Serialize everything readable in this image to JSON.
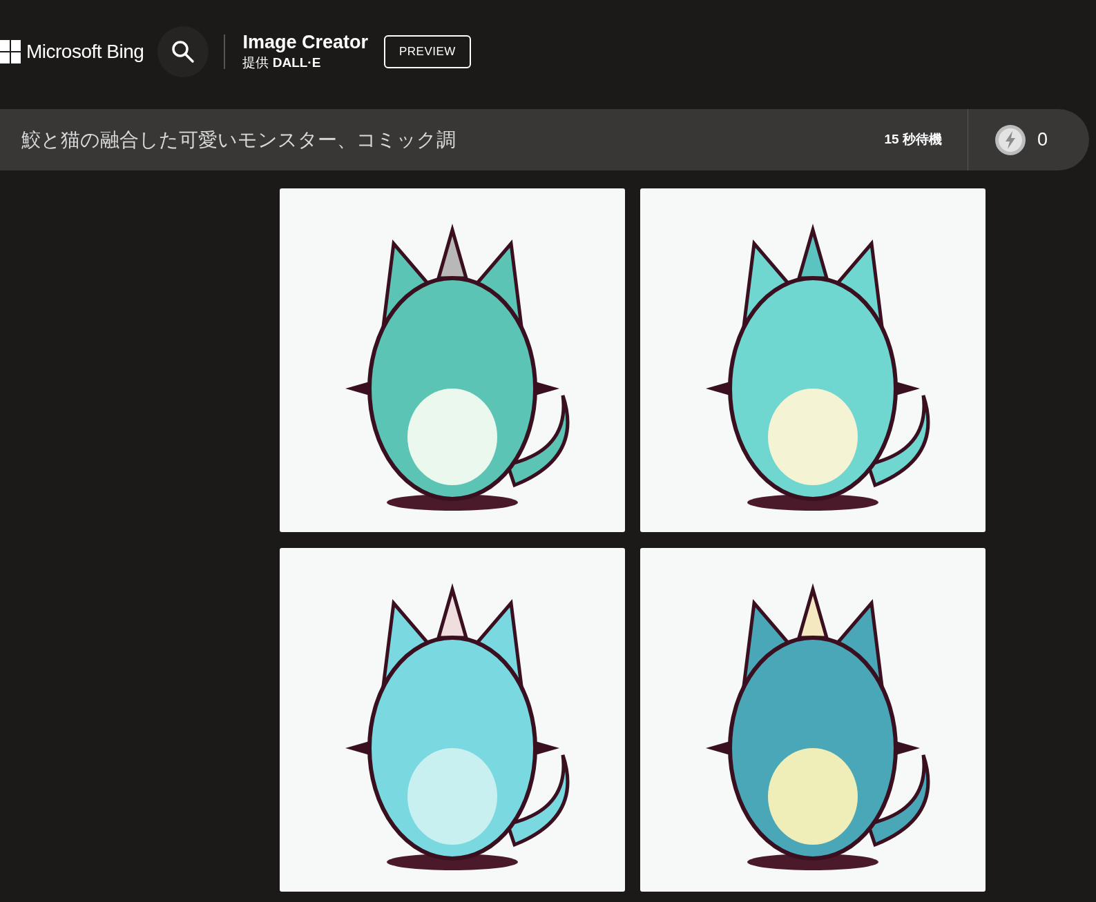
{
  "header": {
    "brand": "Microsoft Bing",
    "title": "Image Creator",
    "subtitle": "提供 **DALL·E**",
    "preview_button": "PREVIEW"
  },
  "prompt_bar": {
    "value": "鮫と猫の融合した可愛いモンスター、コミック調",
    "wait_time": "15 秒待機",
    "boosts": "0"
  }
}
